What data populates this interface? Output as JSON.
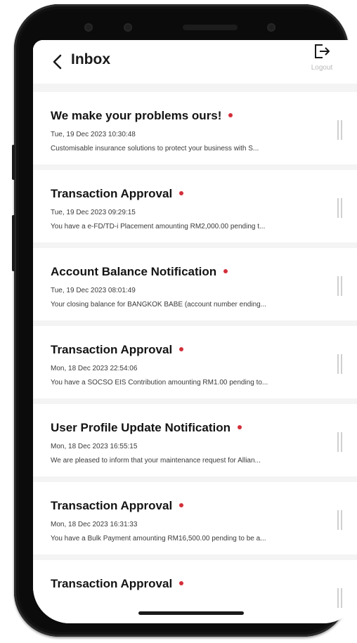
{
  "header": {
    "title": "Inbox",
    "back_icon": "chevron-left-icon",
    "logout_icon": "logout-icon",
    "logout_label": "Logout"
  },
  "colors": {
    "unread_dot": "#d32f3a",
    "screen_background": "#f4f4f4",
    "card_background": "#ffffff"
  },
  "messages": [
    {
      "title": "We make your problems ours!",
      "unread": true,
      "date": "Tue, 19 Dec 2023 10:30:48",
      "preview": "Customisable insurance solutions to protect your business with S..."
    },
    {
      "title": "Transaction Approval",
      "unread": true,
      "date": "Tue, 19 Dec 2023 09:29:15",
      "preview": "You have a e-FD/TD-i Placement amounting RM2,000.00 pending t..."
    },
    {
      "title": "Account Balance Notification",
      "unread": true,
      "date": "Tue, 19 Dec 2023 08:01:49",
      "preview": "Your closing balance for BANGKOK BABE (account number ending..."
    },
    {
      "title": "Transaction Approval",
      "unread": true,
      "date": "Mon, 18 Dec 2023 22:54:06",
      "preview": "You have a SOCSO EIS Contribution amounting RM1.00 pending to..."
    },
    {
      "title": "User Profile Update Notification",
      "unread": true,
      "date": "Mon, 18 Dec 2023 16:55:15",
      "preview": "We are pleased to inform that your maintenance request for Allian..."
    },
    {
      "title": "Transaction Approval",
      "unread": true,
      "date": "Mon, 18 Dec 2023 16:31:33",
      "preview": "You have a Bulk Payment amounting RM16,500.00 pending to be a..."
    },
    {
      "title": "Transaction Approval",
      "unread": true,
      "date": "",
      "preview": ""
    }
  ]
}
